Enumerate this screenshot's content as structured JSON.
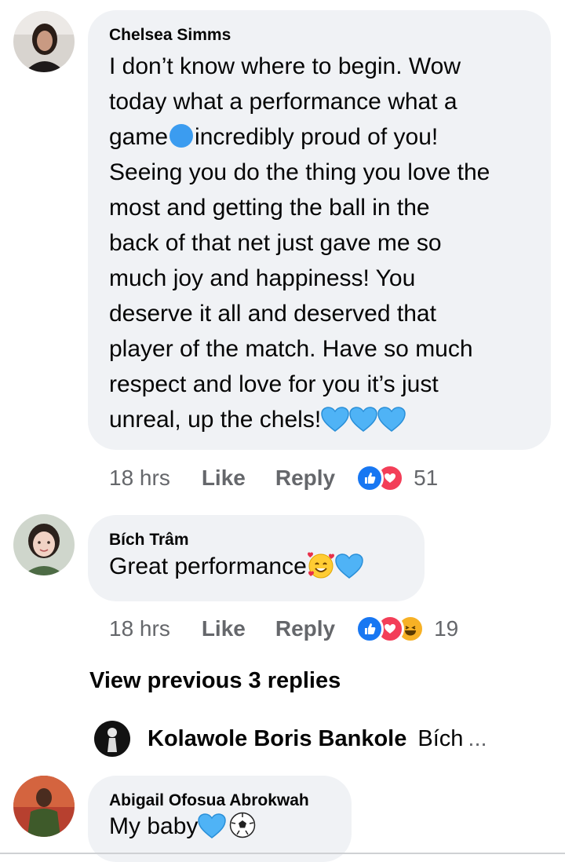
{
  "comments": [
    {
      "author": "Chelsea Simms",
      "text_lines": [
        "I don’t know where to begin. Wow",
        "today what a performance what a",
        "game",
        "incredibly proud of you!",
        "Seeing you do the thing you love the",
        "most and getting the ball in the",
        "back of that net just gave me so",
        "much joy and happiness! You",
        "deserve it all and deserved that",
        "player of the match. Have so much",
        "respect and love for you it’s just",
        "unreal, up the chels!"
      ],
      "time": "18 hrs",
      "like_label": "Like",
      "reply_label": "Reply",
      "reaction_count": "51"
    },
    {
      "author": "Bích Trâm",
      "text": "Great performance",
      "time": "18 hrs",
      "like_label": "Like",
      "reply_label": "Reply",
      "reaction_count": "19"
    },
    {
      "author": "Abigail Ofosua Abrokwah",
      "text": "My baby"
    }
  ],
  "view_previous_label": "View previous 3 replies",
  "latest_reply": {
    "author": "Kolawole Boris Bankole",
    "preview": "Bích",
    "ellipsis": "..."
  },
  "colors": {
    "bubble_bg": "#f0f2f5",
    "meta_text": "#65676b",
    "like_blue": "#1877f2",
    "love_red": "#f33e58",
    "heart_blue": "#4fb3f6"
  }
}
